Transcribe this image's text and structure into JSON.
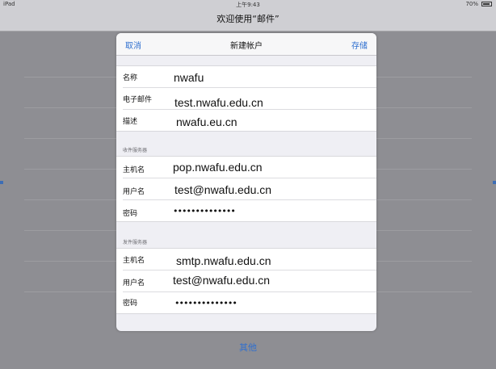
{
  "status_bar": {
    "device": "iPad",
    "time": "上午9:43",
    "battery": "70%"
  },
  "nav": {
    "title": "欢迎使用“邮件”"
  },
  "footer": {
    "other_label": "其他"
  },
  "modal": {
    "cancel_label": "取消",
    "title": "新建帐户",
    "save_label": "存储",
    "account": {
      "name_label": "名称",
      "name_value": "nwafu",
      "email_label": "电子邮件",
      "email_value": "test.nwafu.edu.cn",
      "desc_label": "描述",
      "desc_value": "nwafu.eu.cn"
    },
    "incoming": {
      "section_title": "收件服务器",
      "host_label": "主机名",
      "host_value": "pop.nwafu.edu.cn",
      "user_label": "用户名",
      "user_value": "test@nwafu.edu.cn",
      "password_label": "密码",
      "password_value": "••••••••••••••"
    },
    "outgoing": {
      "section_title": "发件服务器",
      "host_label": "主机名",
      "host_value": "smtp.nwafu.edu.cn",
      "user_label": "用户名",
      "user_value": "test@nwafu.edu.cn",
      "password_label": "密码",
      "password_value": "••••••••••••••"
    }
  },
  "colors": {
    "accent": "#2f6fcf",
    "backdrop": "#8e8e93",
    "sheet": "#efeff4"
  }
}
